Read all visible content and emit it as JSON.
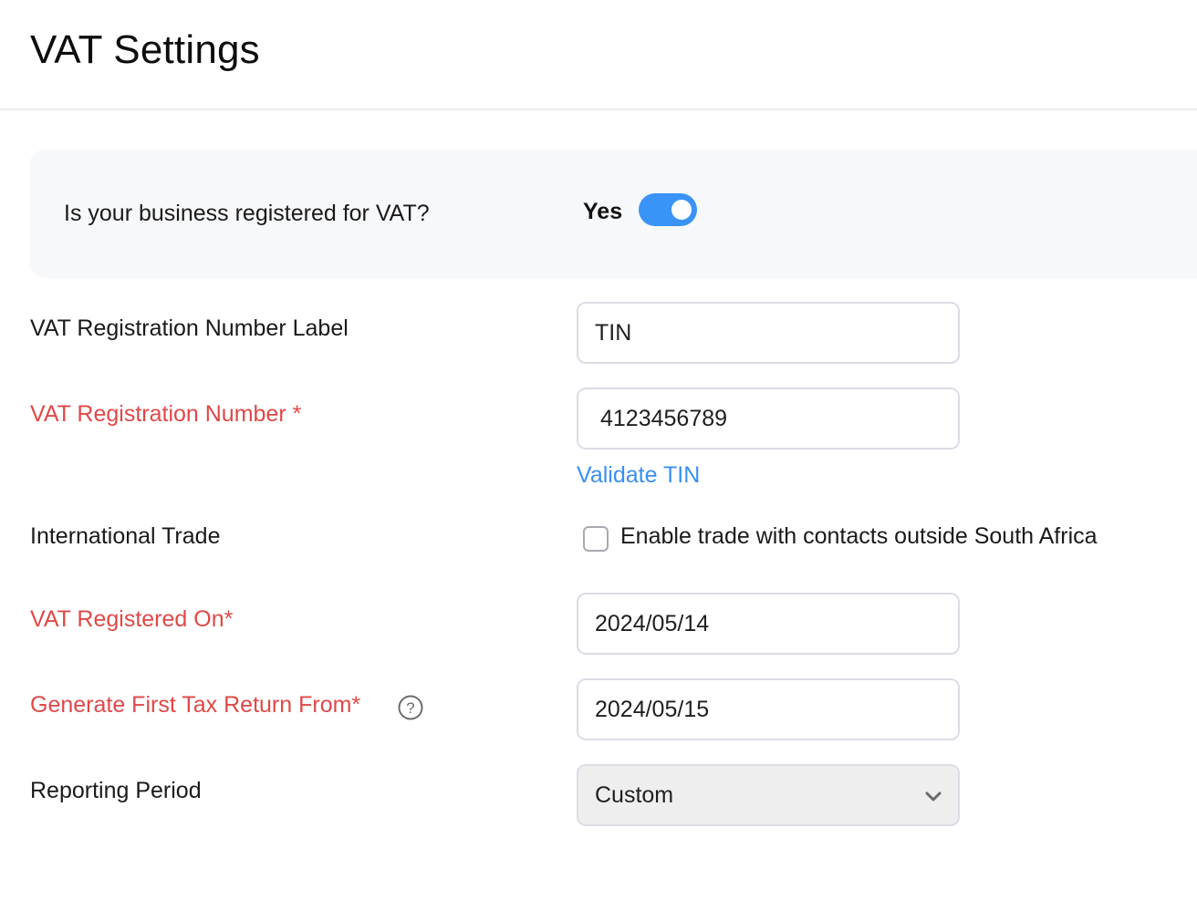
{
  "header": {
    "title": "VAT Settings"
  },
  "vat_registration": {
    "question": "Is your business registered for VAT?",
    "toggle_label": "Yes",
    "toggle_on": true,
    "accent_color": "#3a93f7"
  },
  "fields": {
    "reg_number_label": {
      "label": "VAT Registration Number Label",
      "value": "TIN",
      "required": false
    },
    "reg_number": {
      "label": "VAT Registration Number *",
      "value": "4123456789",
      "required": true,
      "link": "Validate TIN"
    },
    "international_trade": {
      "label": "International Trade",
      "checkbox_label": "Enable trade with contacts outside South Africa",
      "checked": false
    },
    "registered_on": {
      "label": "VAT Registered On*",
      "value": "2024/05/14",
      "required": true
    },
    "first_tax_return": {
      "label": "Generate First Tax Return From*",
      "value": "2024/05/15",
      "required": true,
      "help_icon": "question-circle-icon"
    },
    "reporting_period": {
      "label": "Reporting Period",
      "selected": "Custom"
    }
  },
  "colors": {
    "required_label": "#e04848",
    "link": "#3a8ff0"
  }
}
